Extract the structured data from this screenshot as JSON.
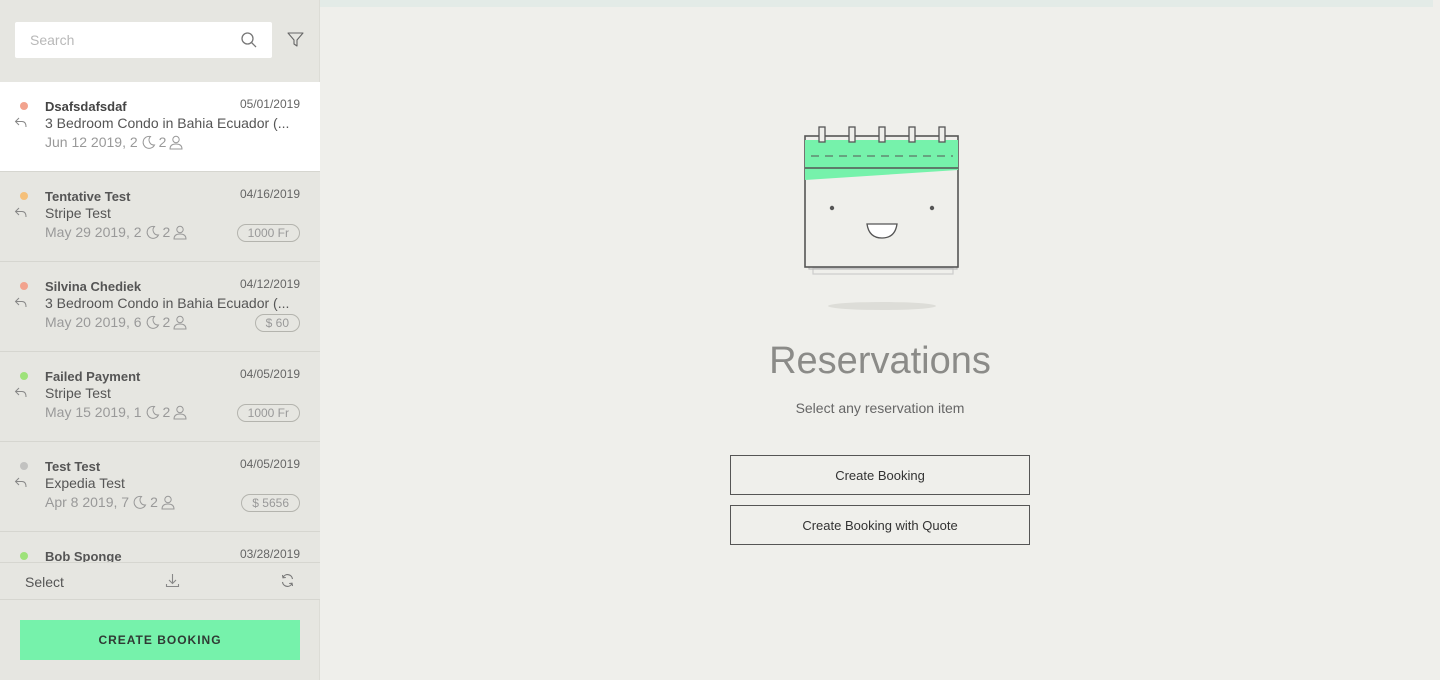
{
  "search": {
    "placeholder": "Search"
  },
  "reservations": [
    {
      "name": "Dsafsdafsdaf",
      "date": "05/01/2019",
      "property": "3 Bedroom Condo in Bahia Ecuador (...",
      "arrival": "Jun 12 2019, 2",
      "guests": "2",
      "badge": "",
      "status_color": "#f2a38e",
      "selected": true
    },
    {
      "name": "Tentative Test",
      "date": "04/16/2019",
      "property": "Stripe Test",
      "arrival": "May 29 2019, 2",
      "guests": "2",
      "badge": "1000 Fr",
      "status_color": "#f5c07a",
      "selected": false
    },
    {
      "name": "Silvina Chediek",
      "date": "04/12/2019",
      "property": "3 Bedroom Condo in Bahia Ecuador (...",
      "arrival": "May 20 2019, 6",
      "guests": "2",
      "badge": "$ 60",
      "status_color": "#f2a38e",
      "selected": false
    },
    {
      "name": "Failed Payment",
      "date": "04/05/2019",
      "property": "Stripe Test",
      "arrival": "May 15 2019, 1",
      "guests": "2",
      "badge": "1000 Fr",
      "status_color": "#9ee27a",
      "selected": false
    },
    {
      "name": "Test Test",
      "date": "04/05/2019",
      "property": "Expedia Test",
      "arrival": "Apr 8 2019, 7",
      "guests": "2",
      "badge": "$ 5656",
      "status_color": "#c2c2c0",
      "selected": false
    },
    {
      "name": "Bob Sponge",
      "date": "03/28/2019",
      "property": "",
      "arrival": "",
      "guests": "",
      "badge": "",
      "status_color": "#9ee27a",
      "selected": false
    }
  ],
  "footer": {
    "select_label": "Select",
    "create_booking_label": "CREATE  BOOKING"
  },
  "main": {
    "title": "Reservations",
    "subtitle": "Select any reservation item",
    "create_booking_label": "Create Booking",
    "create_booking_quote_label": "Create Booking with Quote"
  },
  "icons": [
    "search-icon",
    "filter-icon",
    "reply-icon",
    "moon-icon",
    "person-icon",
    "download-icon",
    "refresh-icon",
    "calendar-illustration"
  ],
  "colors": {
    "accent": "#76f2ab",
    "sidebar_bg": "#e6e6e1",
    "main_bg": "#efefeb"
  }
}
